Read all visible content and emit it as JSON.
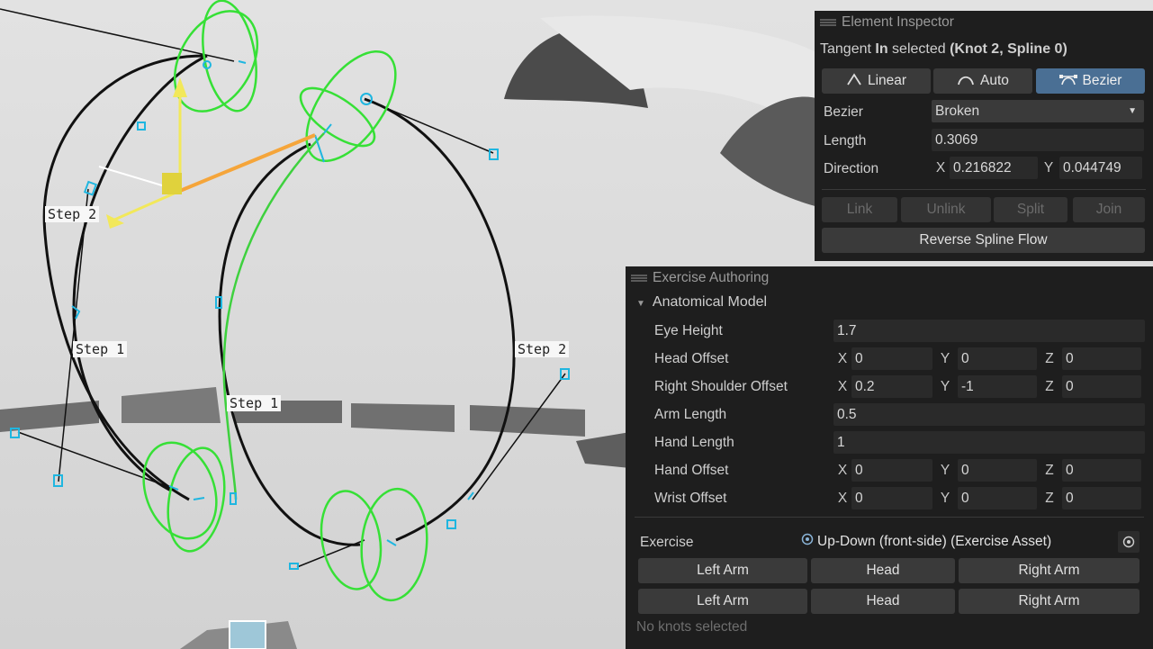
{
  "scene": {
    "labels": [
      "Step 2",
      "Step 1",
      "Step 1",
      "Step 2"
    ]
  },
  "inspector": {
    "title": "Element Inspector",
    "selection": {
      "prefix": "Tangent ",
      "emph": "In",
      "suffix": " selected ",
      "ident": "(Knot 2, Spline 0)"
    },
    "modes": [
      {
        "icon": "linear-tangent-icon",
        "label": "Linear",
        "active": false
      },
      {
        "icon": "auto-tangent-icon",
        "label": "Auto",
        "active": false
      },
      {
        "icon": "bezier-tangent-icon",
        "label": "Bezier",
        "active": true
      }
    ],
    "bezier_label": "Bezier",
    "bezier_value": "Broken",
    "length_label": "Length",
    "length_value": "0.3069",
    "direction_label": "Direction",
    "direction_x_label": "X",
    "direction_x": "0.216822",
    "direction_y_label": "Y",
    "direction_y": "0.044749",
    "actions": [
      "Link",
      "Unlink",
      "Split",
      "Join"
    ],
    "reverse_label": "Reverse Spline Flow"
  },
  "authoring": {
    "title": "Exercise Authoring",
    "foldout": "Anatomical Model",
    "eye_height_label": "Eye Height",
    "eye_height": "1.7",
    "vector_rows": [
      {
        "label": "Head Offset",
        "x": "0",
        "y": "0",
        "z": "0"
      },
      {
        "label": "Right Shoulder Offset",
        "x": "0.2",
        "y": "-1",
        "z": "0"
      }
    ],
    "arm_length_label": "Arm Length",
    "arm_length": "0.5",
    "hand_length_label": "Hand Length",
    "hand_length": "1",
    "vector_rows2": [
      {
        "label": "Hand Offset",
        "x": "0",
        "y": "0",
        "z": "0"
      },
      {
        "label": "Wrist Offset",
        "x": "0",
        "y": "0",
        "z": "0"
      }
    ],
    "axis_labels": {
      "x": "X",
      "y": "Y",
      "z": "Z"
    },
    "exercise_label": "Exercise",
    "exercise_value": "Up-Down (front-side) (Exercise Asset)",
    "buttons_row1": [
      "Left Arm",
      "Head",
      "Right Arm"
    ],
    "buttons_row2": [
      "Left Arm",
      "Head",
      "Right Arm"
    ],
    "status": "No knots selected"
  }
}
